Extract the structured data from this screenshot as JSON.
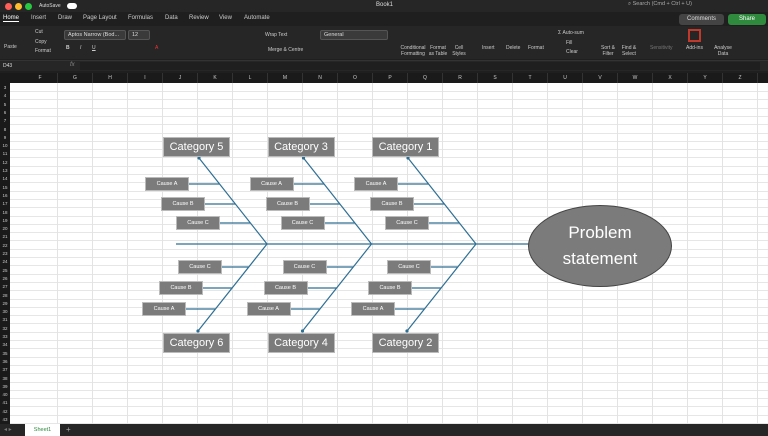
{
  "window": {
    "title": "Book1",
    "autosave": "AutoSave",
    "search": "Search (Cmd + Ctrl + U)"
  },
  "tabs": [
    "Home",
    "Insert",
    "Draw",
    "Page Layout",
    "Formulas",
    "Data",
    "Review",
    "View",
    "Automate"
  ],
  "header_buttons": {
    "comments": "Comments",
    "share": "Share"
  },
  "ribbon": {
    "paste": "Paste",
    "cut": "Cut",
    "copy": "Copy",
    "format": "Format",
    "font": "Aptos Narrow (Bod...",
    "size": "12",
    "wrap": "Wrap Text",
    "merge": "Merge & Centre",
    "number_format": "General",
    "cond": "Conditional Formatting",
    "fmt_table": "Format as Table",
    "cell_styles": "Cell Styles",
    "insert": "Insert",
    "delete": "Delete",
    "format2": "Format",
    "autosum": "Auto-sum",
    "fill": "Fill",
    "clear": "Clear",
    "sort": "Sort & Filter",
    "find": "Find & Select",
    "sensitivity": "Sensitivity",
    "addins": "Add-ins",
    "analyse": "Analyse Data"
  },
  "formula_bar": {
    "cell_ref": "D43",
    "fx": "fx",
    "value": ""
  },
  "columns": [
    "F",
    "G",
    "H",
    "I",
    "J",
    "K",
    "L",
    "M",
    "N",
    "O",
    "P",
    "Q",
    "R",
    "S",
    "T",
    "U",
    "V",
    "W",
    "X",
    "Y",
    "Z"
  ],
  "rows": [
    "3",
    "4",
    "5",
    "6",
    "7",
    "8",
    "9",
    "10",
    "11",
    "12",
    "13",
    "14",
    "15",
    "16",
    "17",
    "18",
    "19",
    "20",
    "21",
    "22",
    "23",
    "24",
    "25",
    "26",
    "27",
    "28",
    "29",
    "30",
    "31",
    "32",
    "33",
    "34",
    "35",
    "36",
    "37",
    "38",
    "39",
    "40",
    "41",
    "42",
    "43"
  ],
  "diagram": {
    "problem": "Problem statement",
    "top_categories": [
      "Category 5",
      "Category 3",
      "Category 1"
    ],
    "bottom_categories": [
      "Category 6",
      "Category 4",
      "Category 2"
    ],
    "top_causes": [
      "Cause A",
      "Cause B",
      "Cause C"
    ],
    "bottom_causes": [
      "Cause C",
      "Cause B",
      "Cause A"
    ],
    "line_color": "#2e6f95"
  },
  "sheet_tabs": [
    "Sheet1"
  ],
  "add_sheet": "+"
}
